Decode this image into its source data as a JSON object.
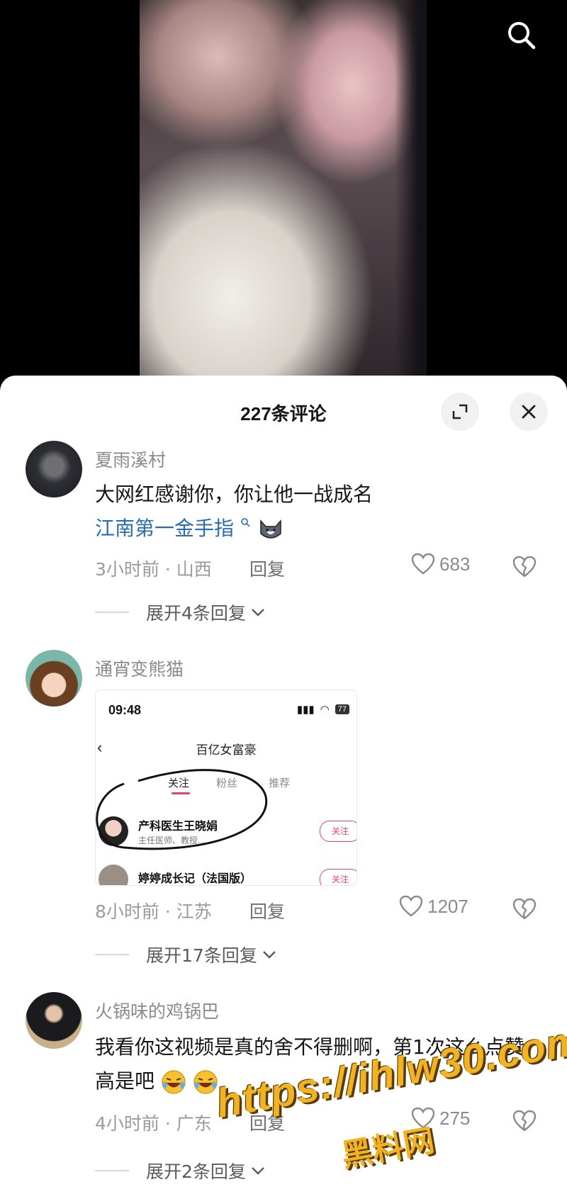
{
  "header": {
    "title": "227条评论"
  },
  "comments": [
    {
      "username": "夏雨溪村",
      "text": "大网红感谢你，你让他一战成名",
      "link": "江南第一金手指",
      "meta": "3小时前 · 山西",
      "reply_label": "回复",
      "likes": "683",
      "expand_label": "展开4条回复"
    },
    {
      "username": "通宵变熊猫",
      "image": {
        "time": "09:48",
        "battery": "77",
        "title": "百亿女富豪",
        "tabs": [
          "关注",
          "粉丝",
          "推荐"
        ],
        "user1_name": "产科医生王晓娟",
        "user1_desc": "主任医师、教授...",
        "user2_name": "婷婷成长记（法国版）",
        "follow_label": "关注"
      },
      "meta": "8小时前 · 江苏",
      "reply_label": "回复",
      "likes": "1207",
      "expand_label": "展开17条回复"
    },
    {
      "username": "火锅味的鸡锅巴",
      "text": "我看你这视频是真的舍不得删啊，第1次这么点赞高是吧",
      "meta": "4小时前 · 广东",
      "reply_label": "回复",
      "likes": "275",
      "expand_label": "展开2条回复"
    }
  ],
  "watermark": {
    "url": "https://ihlw30.com",
    "name": "黑料网"
  },
  "colors": {
    "link": "#2b6cb0",
    "accent": "#e5455e",
    "watermark": "#f1b321"
  }
}
